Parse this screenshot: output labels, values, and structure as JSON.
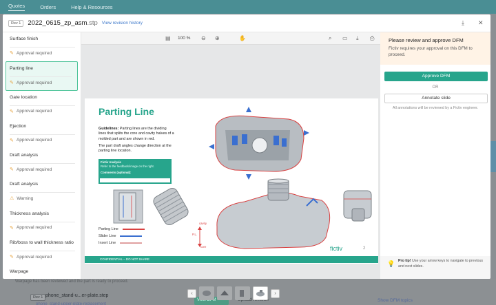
{
  "nav": {
    "items": [
      "Quotes",
      "Orders",
      "Help & Resources"
    ]
  },
  "modal": {
    "rev_badge": "Rev 1",
    "file_base": "2022_0615_zp_asm",
    "file_ext": ".stp",
    "revision_history": "View revision history"
  },
  "checklist": [
    {
      "title": "Surface finish",
      "status": "Approval required"
    },
    {
      "title": "Parting line",
      "status": "Approval required"
    },
    {
      "title": "Gate location",
      "status": "Approval required"
    },
    {
      "title": "Ejection",
      "status": "Approval required"
    },
    {
      "title": "Draft analysis",
      "status": "Approval required"
    },
    {
      "title": "Draft analysis",
      "status": "Warning"
    },
    {
      "title": "Thickness analysis",
      "status": "Approval required"
    },
    {
      "title": "Rib/boss to wall thickness ratio",
      "status": "Approval required"
    },
    {
      "title": "Warpage",
      "status": ""
    }
  ],
  "viewer": {
    "zoom": "100 %"
  },
  "slide": {
    "title": "Parting Line",
    "guidelines_label": "Guidelines:",
    "guidelines": "Parting lines are the dividing lines that splits the core and cavity halves of a molded part and are shown in red.",
    "note": "The part draft angles change direction at the parting line location.",
    "box_title": "Fictiv Analysis",
    "box_text": "Refer to the feedback/image on the right.",
    "box_comments": "Comments (optional):",
    "legend": [
      {
        "label": "Parting Line",
        "color": "#d94141"
      },
      {
        "label": "Slider Line",
        "color": "#3a6fd0"
      },
      {
        "label": "Insert Line",
        "color": "#e0a0a0"
      }
    ],
    "cavity": "cavity",
    "pl": "P.L.",
    "core": "core",
    "footer": "CONFIDENTIAL – DO NOT SHARE",
    "logo": "fictiv",
    "page": "2"
  },
  "panel": {
    "heading": "Please review and approve DFM",
    "body": "Fictiv requires your approval on this DFM to proceed.",
    "approve": "Approve DFM",
    "or": "OR",
    "annotate": "Annotate slide",
    "note": "All annotations will be reviewed by a Fictiv engineer.",
    "tip_bold": "Pro tip!",
    "tip": "Use your arrow keys to navigate to previous and next slides."
  },
  "background": {
    "line": "Warpage has been reviewed and the part is ready to proceed.",
    "rev": "Rev 1",
    "part": "phone_stand-u...er-plate.step",
    "part2": "phone_stand-upper-plate-replacement",
    "view_btn": "View DFM",
    "upload": "Upload revision",
    "show_dfm": "Show DFM topics"
  }
}
